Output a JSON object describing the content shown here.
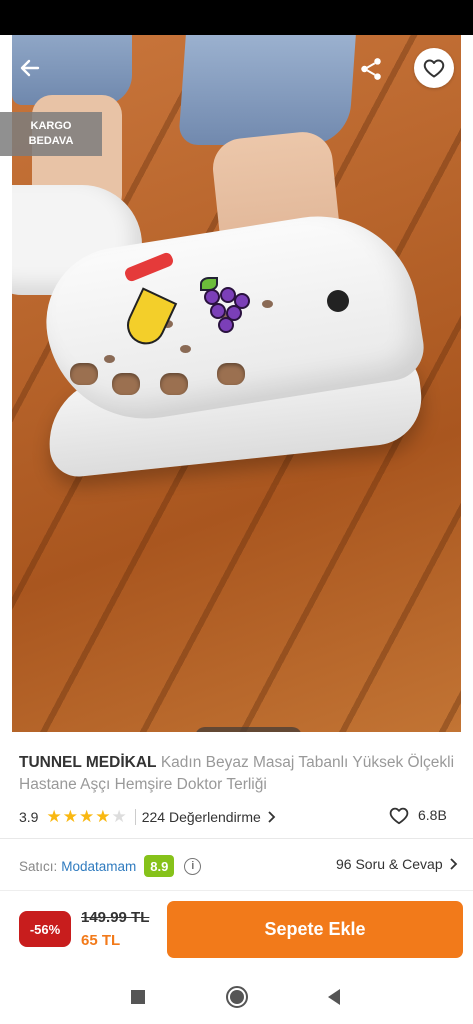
{
  "product": {
    "brand": "TUNNEL MEDİKAL",
    "name": "Kadın Beyaz Masaj Tabanlı Yüksek Ölçekli Hastane Aşçı Hemşire Doktor Terliği",
    "badge_line1": "KARGO",
    "badge_line2": "BEDAVA",
    "image_count": 5,
    "active_image": 1
  },
  "rating": {
    "score": "3.9",
    "stars_filled": 4,
    "stars_total": 5,
    "reviews_label": "224 Değerlendirme",
    "favorites": "6.8B"
  },
  "seller": {
    "label": "Satıcı:",
    "name": "Modatamam",
    "score": "8.9",
    "qa_label": "96 Soru & Cevap"
  },
  "purchase": {
    "discount": "-56%",
    "old_price": "149.99 TL",
    "new_price": "65 TL",
    "cart_label": "Sepete Ekle"
  },
  "colors": {
    "accent": "#f27a1a",
    "discount": "#c81d1d",
    "seller_score": "#86c21a",
    "seller_link": "#2f7bbf"
  },
  "icons": {
    "back": "arrow-left-icon",
    "share": "share-icon",
    "favorite": "heart-icon",
    "star": "star-icon",
    "info": "info-icon",
    "chevron": "chevron-right-icon",
    "nav_recents": "square-icon",
    "nav_home": "circle-icon",
    "nav_back": "triangle-back-icon"
  }
}
